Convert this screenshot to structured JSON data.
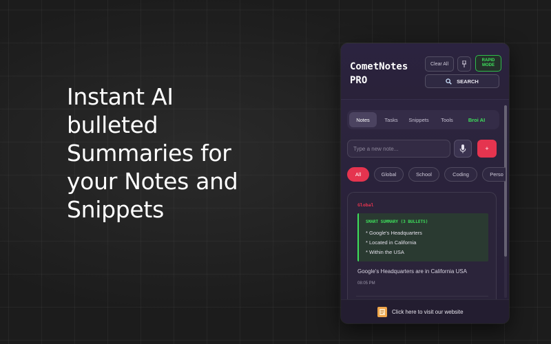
{
  "hero": {
    "lines": [
      "Instant AI",
      "bulleted",
      "Summaries for",
      "your Notes and",
      "Snippets"
    ]
  },
  "app": {
    "title_line1": "CometNotes",
    "title_line2": "PRO",
    "clear_label": "Clear All",
    "pin_icon": "pin-icon",
    "rapid_line1": "RAPID",
    "rapid_line2": "MODE",
    "search_label": "SEARCH",
    "search_icon": "magnifier-icon"
  },
  "tabs": [
    {
      "label": "Notes",
      "active": true
    },
    {
      "label": "Tasks",
      "active": false
    },
    {
      "label": "Snippets",
      "active": false
    },
    {
      "label": "Tools",
      "active": false
    },
    {
      "label": "Broi AI",
      "active": false
    }
  ],
  "composer": {
    "placeholder": "Type a new note...",
    "mic_icon": "microphone-icon",
    "add_label": "+"
  },
  "filters": [
    {
      "label": "All",
      "active": true
    },
    {
      "label": "Global",
      "active": false
    },
    {
      "label": "School",
      "active": false
    },
    {
      "label": "Coding",
      "active": false
    },
    {
      "label": "Perso",
      "active": false
    }
  ],
  "note": {
    "tag": "Global",
    "summary_title": "SMART SUMMARY (3 BULLETS)",
    "bullets": [
      "* Google's Headquarters",
      "* Located in California",
      "* Within the USA"
    ],
    "text": "Google's Headquarters are in California USA",
    "time": "08:05 PM"
  },
  "footer": {
    "link_label": "Click here to visit our website",
    "icon": "document-icon"
  },
  "colors": {
    "accent_red": "#e5344f",
    "accent_green": "#3ee05c",
    "panel_bg": "#2e2640"
  }
}
